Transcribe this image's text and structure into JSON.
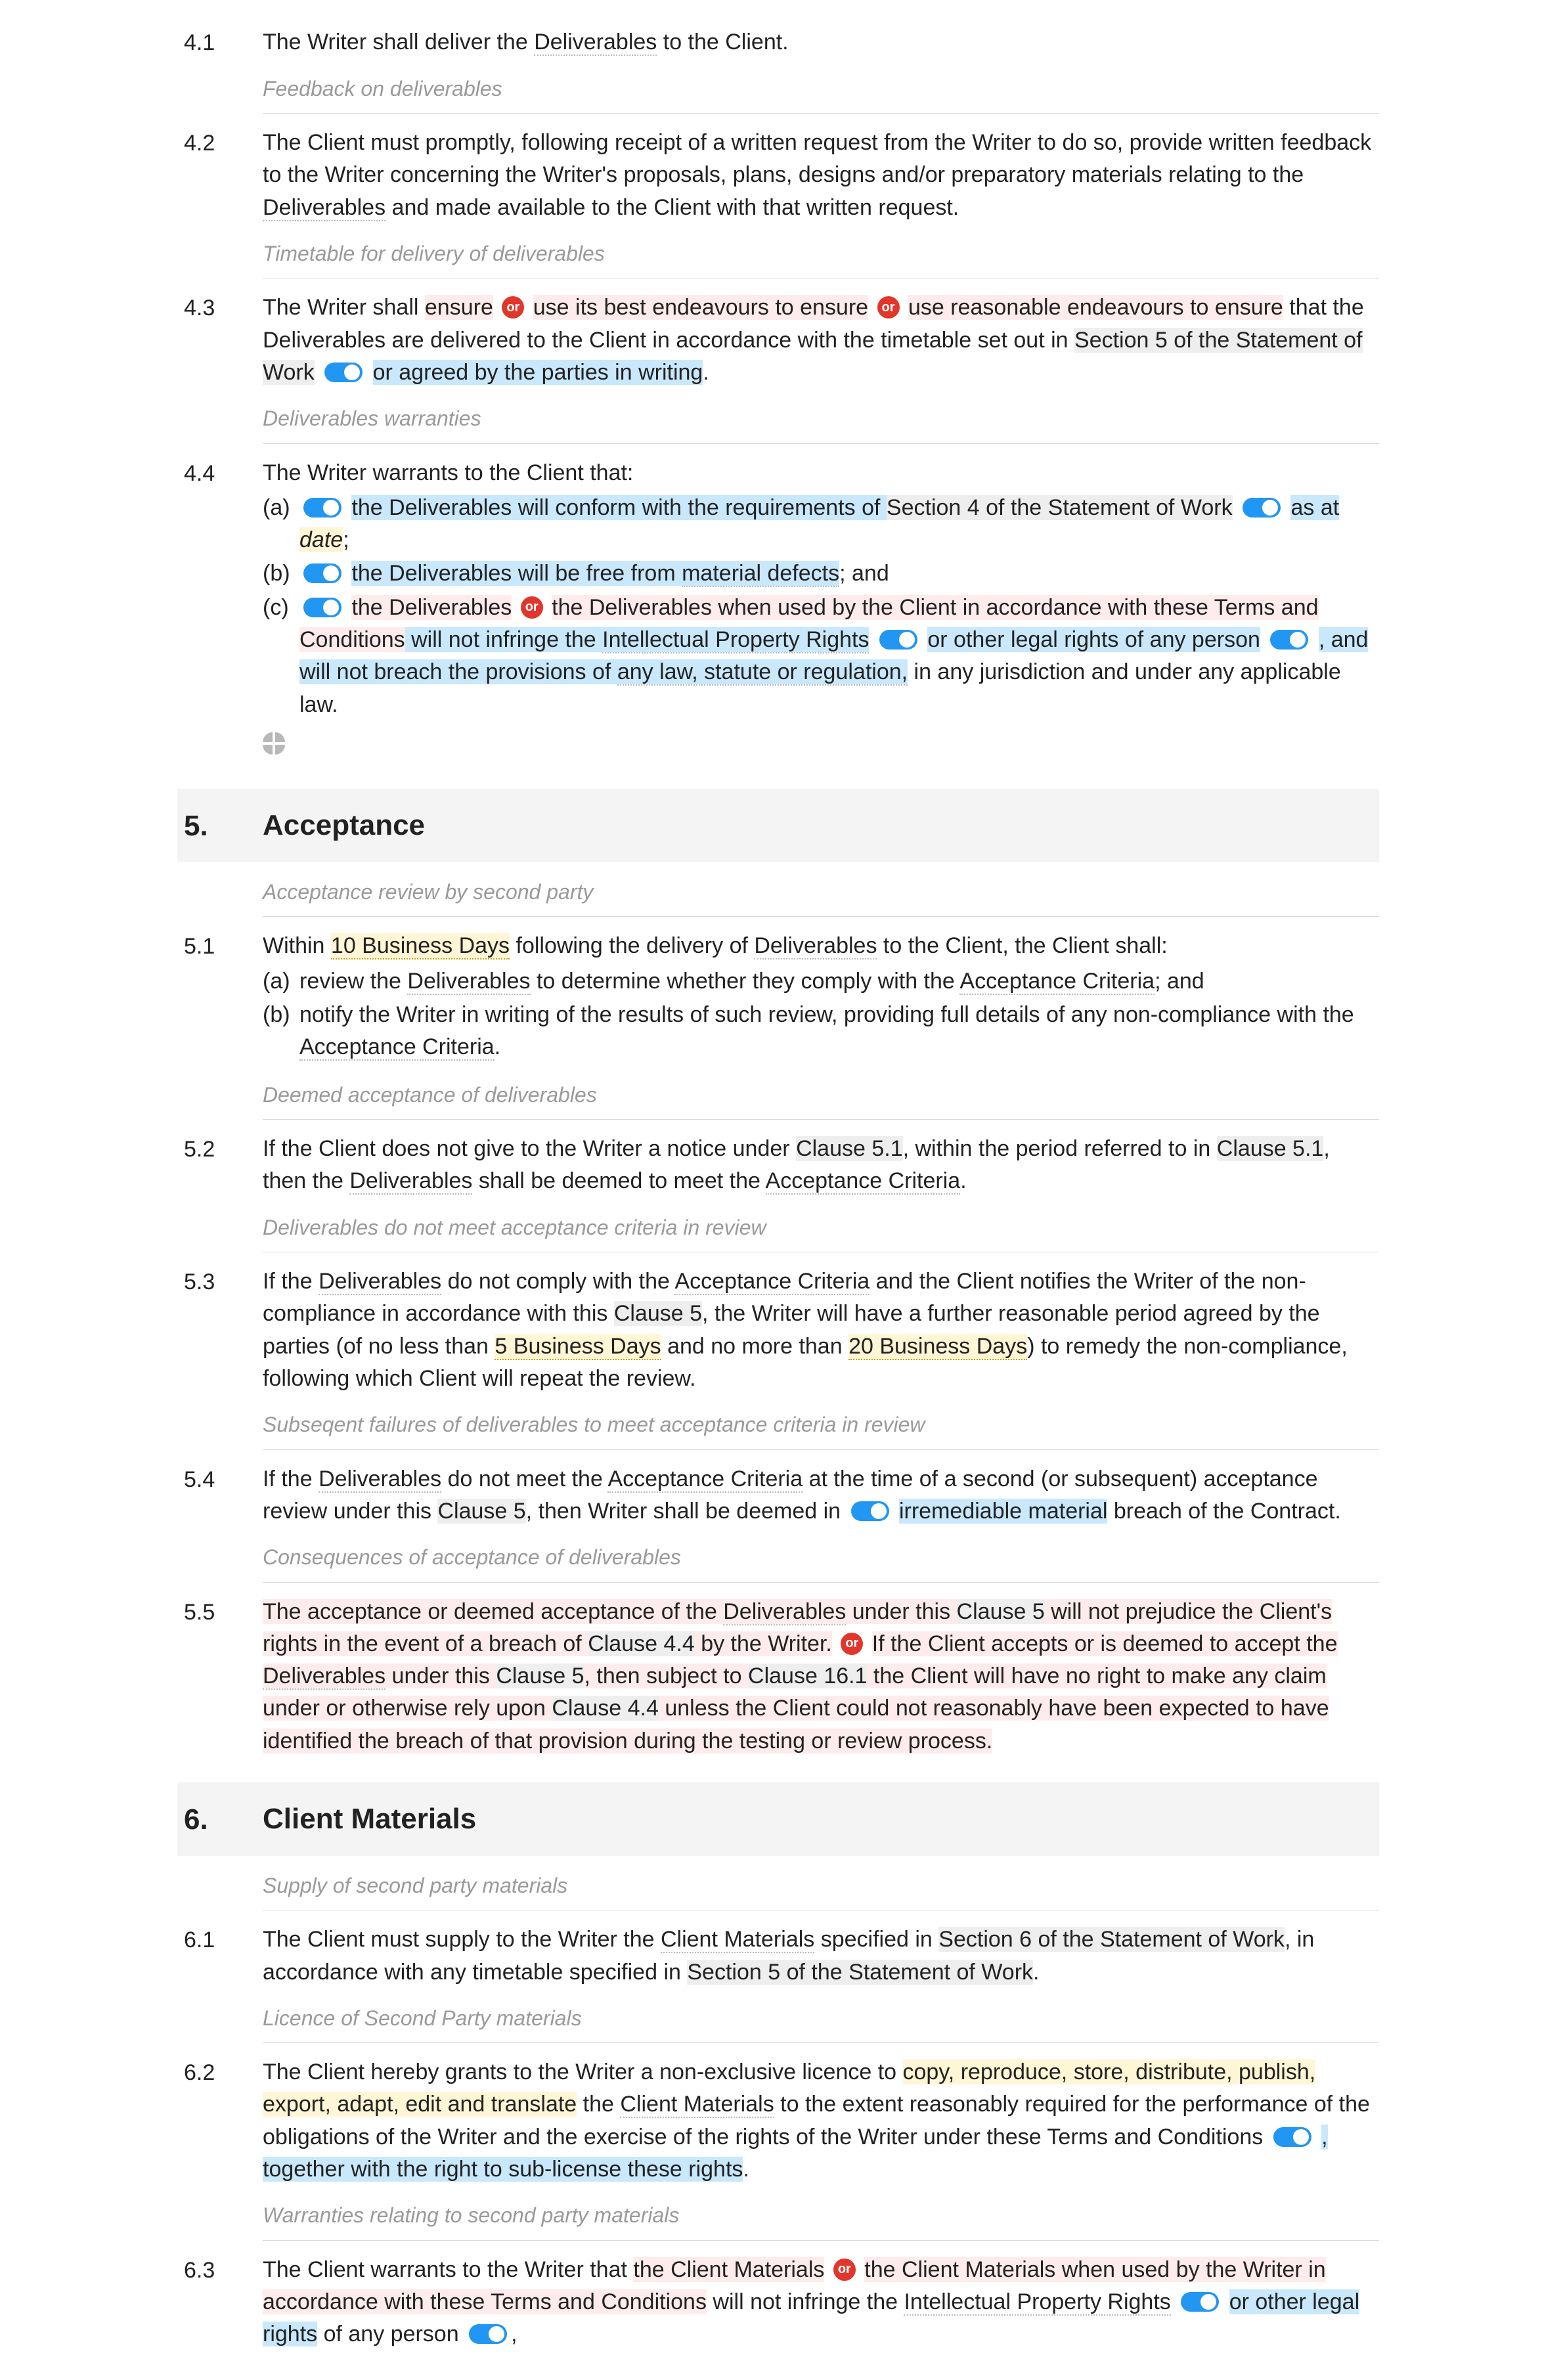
{
  "c41": {
    "num": "4.1",
    "t1": "The Writer shall deliver the ",
    "deliv": "Deliverables",
    "t2": " to the Client."
  },
  "note_fb": "Feedback on deliverables",
  "c42": {
    "num": "4.2",
    "t1": "The Client must promptly, following receipt of a written request from the Writer to do so, provide written feedback to the Writer concerning the Writer's proposals, plans, designs and/or preparatory materials relating to the ",
    "deliv": "Deliverables",
    "t2": " and made available to the Client with that written request."
  },
  "note_tt": "Timetable for delivery of deliverables",
  "c43": {
    "num": "4.3",
    "t1": "The Writer shall ",
    "opt1": "ensure",
    "opt2": "use its best endeavours to ensure",
    "opt3": "use reasonable endeavours to ensure",
    "t2": " that the Deliverables are delivered to the Client in accordance with the timetable set out in ",
    "sec": "Section 5 of the Statement of Work",
    "tog1_text": " or agreed by the parties in writing",
    "t3": "."
  },
  "note_dw": "Deliverables warranties",
  "c44": {
    "num": "4.4",
    "intro": "The Writer warrants to the Client that:",
    "a_label": "(a)",
    "a_t1": "the Deliverables will conform with the requirements of ",
    "a_sec": "Section 4 of the Statement of Work",
    "a_t2": " as at ",
    "a_date": "date",
    "a_t3": ";",
    "b_label": "(b)",
    "b_t1": "the Deliverables will be free from ",
    "b_def": "material defects",
    "b_t2": "; and",
    "c_label": "(c)",
    "c_opt1": "the Deliverables",
    "c_opt2": "the Deliverables when used by the Client in accordance with these Terms and Conditions",
    "c_t1": " will not infringe the ",
    "c_ipr": "Intellectual Property Rights",
    "c_tog1": " or other legal rights",
    "c_t2": " of any person",
    "c_tog2_a": ", and will not breach the provisions of ",
    "c_tog2_b": "any law, statute or regulation,",
    "c_t3": " in any jurisdiction and under any applicable law."
  },
  "sec5": {
    "num": "5.",
    "title": "Acceptance"
  },
  "note_ar": "Acceptance review by second party",
  "c51": {
    "num": "5.1",
    "t1": "Within ",
    "days": "10 Business Days",
    "t2": " following the delivery of ",
    "deliv": "Deliverables",
    "t3": " to the Client, the Client shall:",
    "a_label": "(a)",
    "a_t1": "review the ",
    "a_deliv": "Deliverables",
    "a_t2": " to determine whether they comply with the ",
    "a_ac": "Acceptance Criteria",
    "a_t3": "; and",
    "b_label": "(b)",
    "b_t1": "notify the Writer in writing of the results of such review, providing full details of any non-compliance with the ",
    "b_ac": "Acceptance Criteria",
    "b_t2": "."
  },
  "note_da": "Deemed acceptance of deliverables",
  "c52": {
    "num": "5.2",
    "t1": "If the Client does not give to the Writer a notice under ",
    "cl1": "Clause 5.1",
    "t2": ", within the period referred to in ",
    "cl2": "Clause 5.1",
    "t3": ", then the ",
    "deliv": "Deliverables",
    "t4": " shall be deemed to meet the ",
    "ac": "Acceptance Criteria",
    "t5": "."
  },
  "note_dn": "Deliverables do not meet acceptance criteria in review",
  "c53": {
    "num": "5.3",
    "t1": "If the ",
    "deliv": "Deliverables",
    "t2": " do not comply with the ",
    "ac": "Acceptance Criteria",
    "t3": " and the Client notifies the Writer of the non-compliance in accordance with this ",
    "cl": "Clause 5",
    "t4": ", the Writer will have a further reasonable period agreed by the parties (of no less than ",
    "d1": "5 Business Days",
    "t5": " and no more than ",
    "d2": "20 Business Days",
    "t6": ") to remedy the non-compliance, following which Client will repeat the review."
  },
  "note_sf": "Subseqent failures of deliverables to meet acceptance criteria in review",
  "c54": {
    "num": "5.4",
    "t1": "If the ",
    "deliv": "Deliverables",
    "t2": " do not meet the ",
    "ac": "Acceptance Criteria",
    "t3": " at the time of a second (or subsequent) acceptance review under this ",
    "cl": "Clause 5",
    "t4": ", then Writer shall be deemed in ",
    "tog": "irremediable material",
    "t5": " breach of the Contract."
  },
  "note_ca": "Consequences of acceptance of deliverables",
  "c55": {
    "num": "5.5",
    "p1a": "The acceptance or deemed acceptance of the ",
    "p1_deliv": "Deliverables",
    "p1b": " under this ",
    "p1_cl": "Clause 5",
    "p1c": " will not prejudice the Client's rights in the event of a breach of ",
    "p1_cl2": "Clause 4.4",
    "p1d": " by the Writer.",
    "p2a": "If the Client accepts or is deemed to accept the ",
    "p2_deliv": "Deliverables",
    "p2b": " under this ",
    "p2_cl": "Clause 5",
    "p2c": ", then subject to ",
    "p2_cl2": "Clause 16.1",
    "p2d": " the Client will have no right to make any claim under or otherwise rely upon ",
    "p2_cl3": "Clause 4.4",
    "p2e": " unless the Client could not reasonably have been expected to have identified the breach of that provision during the testing or review process."
  },
  "sec6": {
    "num": "6.",
    "title": "Client Materials"
  },
  "note_sp": "Supply of second party materials",
  "c61": {
    "num": "6.1",
    "t1": "The Client must supply to the Writer the ",
    "cm": "Client Materials",
    "t2": " specified in ",
    "sec6": "Section 6 of the Statement of Work",
    "t3": ", in accordance with any timetable specified in ",
    "sec5": "Section 5 of the Statement of Work",
    "t4": "."
  },
  "note_lm": "Licence of Second Party materials",
  "c62": {
    "num": "6.2",
    "t1": "The Client hereby grants to the Writer a non-exclusive licence to ",
    "verbs": "copy, reproduce, store, distribute, publish, export, adapt, edit and translate",
    "t2": " the ",
    "cm": "Client Materials",
    "t3": " to the extent reasonably required for the performance of the obligations of the Writer and the exercise of the rights of the Writer under these Terms and Conditions",
    "tog": ", together with the right to sub-license these rights",
    "t4": "."
  },
  "note_wr": "Warranties relating to second party materials",
  "c63": {
    "num": "6.3",
    "t1": "The Client warrants to the Writer that ",
    "opt1": "the Client Materials",
    "opt2": "the Client Materials when used by the Writer in accordance with these Terms and Conditions",
    "t2": " will not infringe the ",
    "ipr": "Intellectual Property Rights",
    "tog1": " or other legal rights",
    "t3": " of any person",
    "t4": ","
  },
  "or_label": "or"
}
